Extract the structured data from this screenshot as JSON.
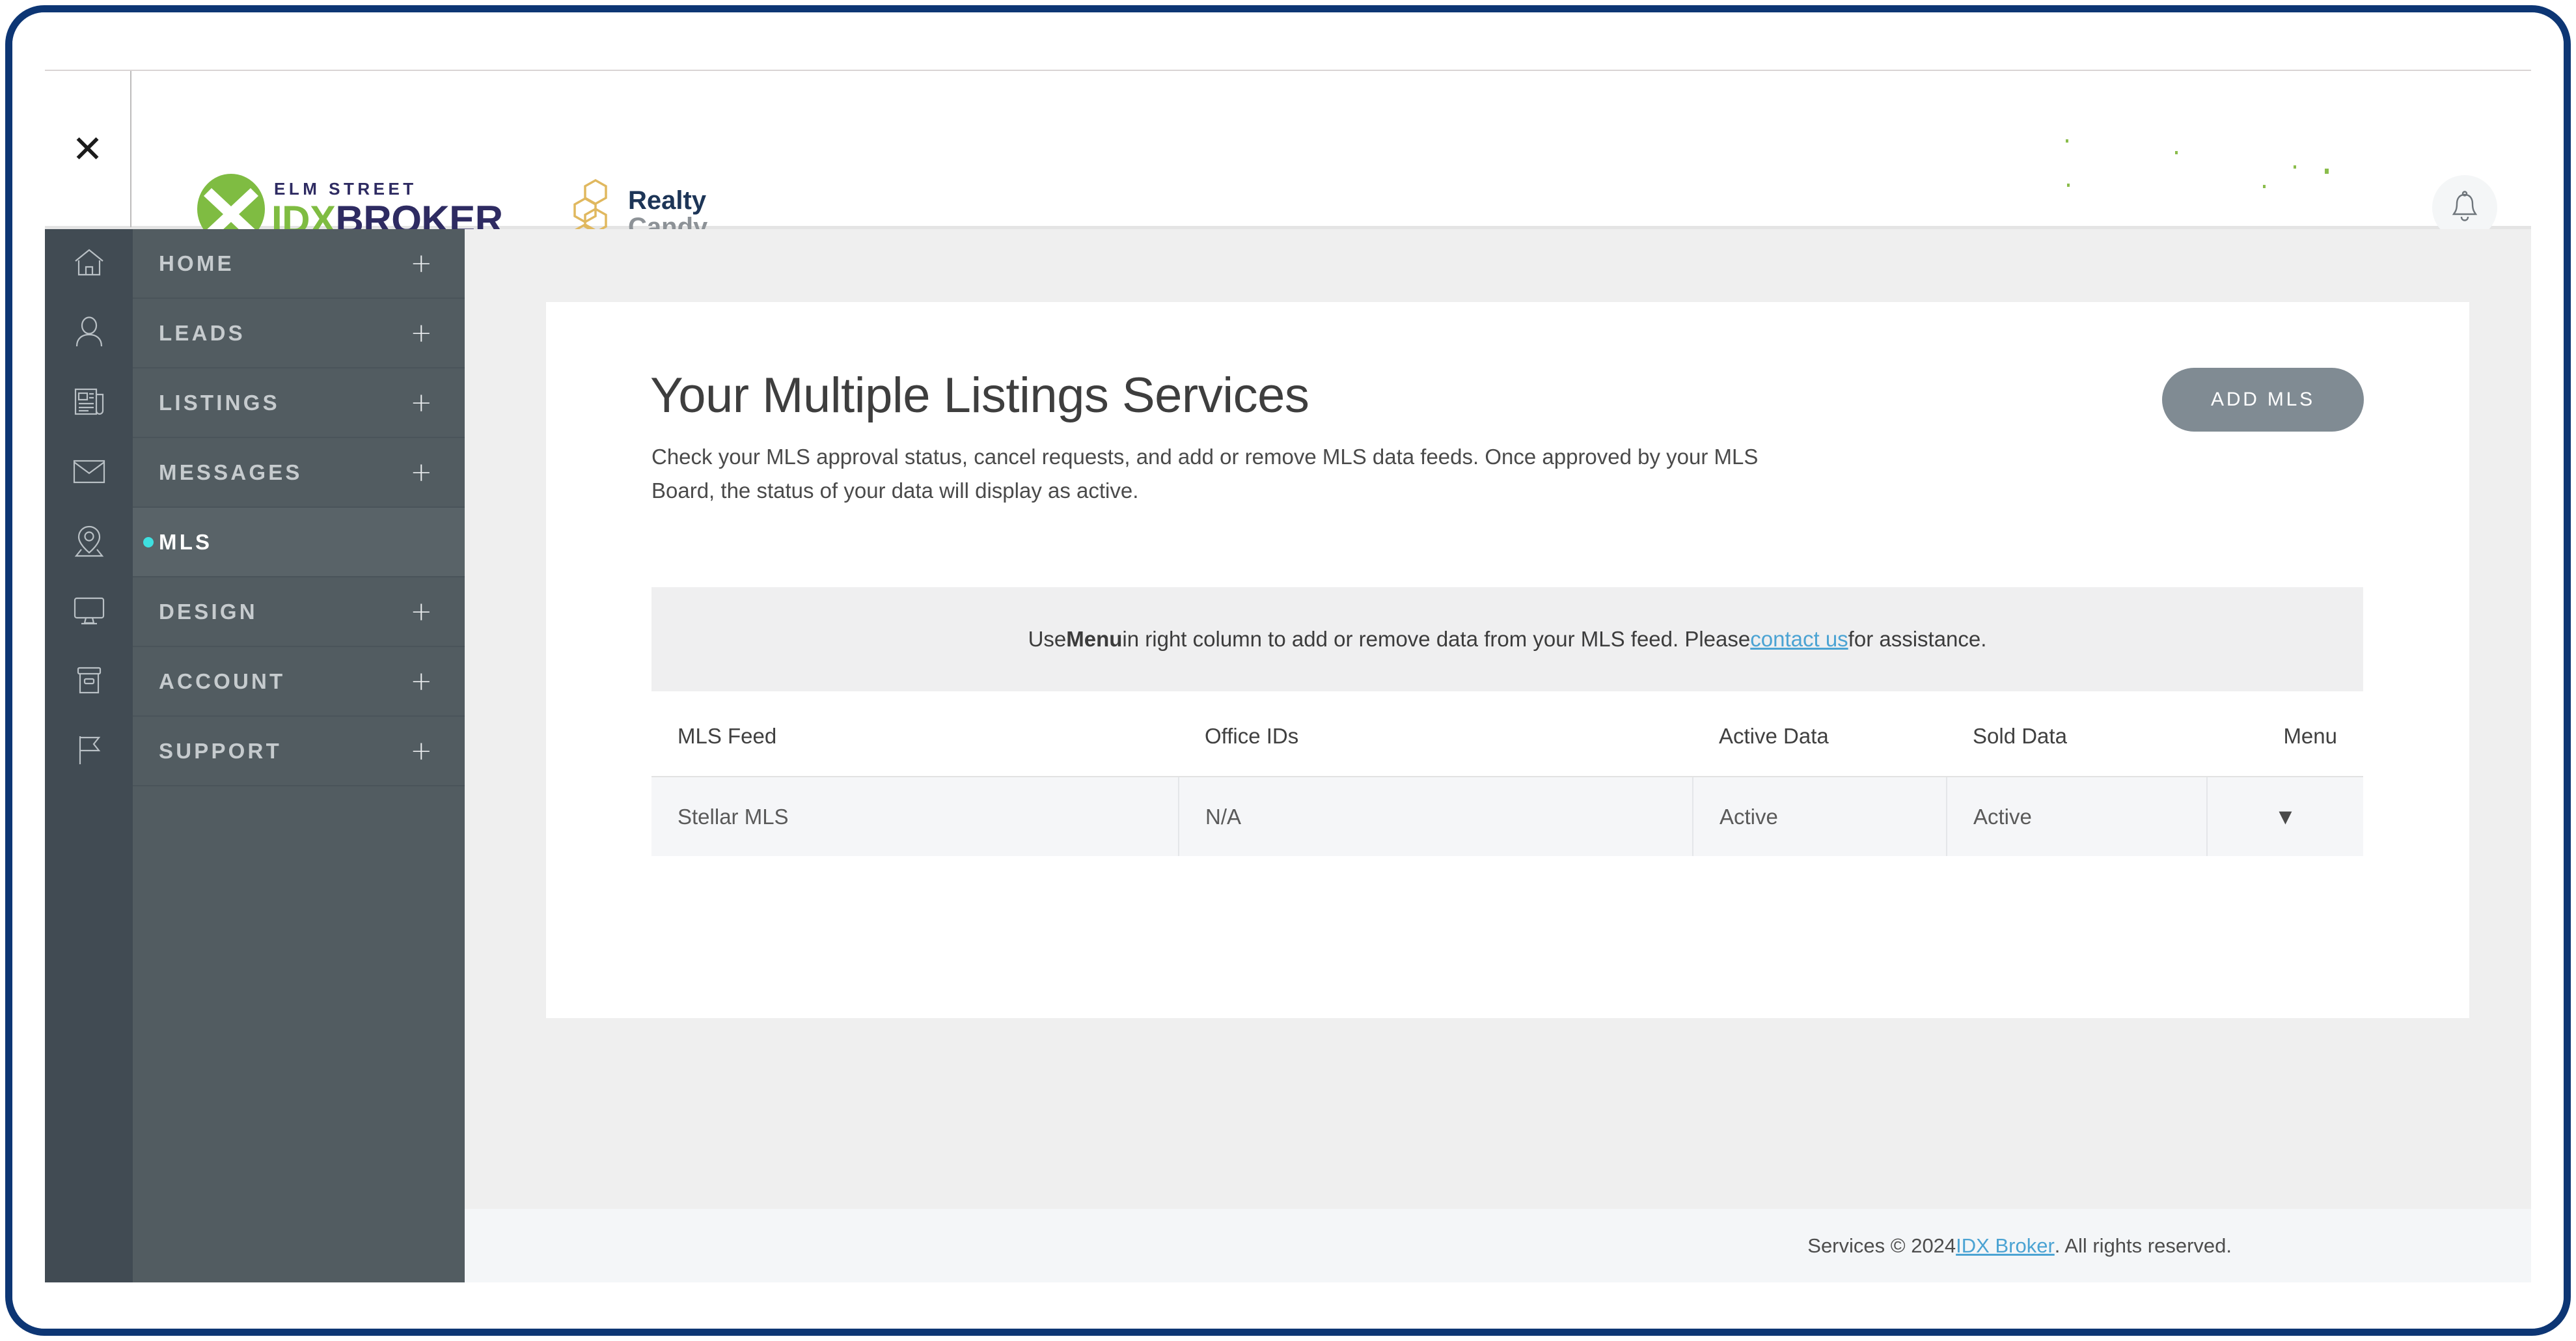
{
  "frame": {
    "border_color": "#0d3674"
  },
  "header": {
    "close_icon": "close-icon",
    "close_glyph": "✕",
    "logo_idx": {
      "eyebrow": "ELM STREET",
      "name_green": "IDX",
      "name_navy": "BROKER",
      "mark_letter": "X",
      "green": "#7fbc42",
      "navy": "#2e2b62"
    },
    "logo_realty": {
      "line1": "Realty",
      "line2": "Candy",
      "navy": "#1d3557",
      "gray": "#8d9297",
      "gold": "#e0b85f"
    },
    "bell_icon": "bell-icon"
  },
  "icon_rail": [
    {
      "name": "home-icon"
    },
    {
      "name": "user-icon"
    },
    {
      "name": "newspaper-icon"
    },
    {
      "name": "envelope-icon"
    },
    {
      "name": "map-pin-icon"
    },
    {
      "name": "monitor-icon"
    },
    {
      "name": "archive-box-icon"
    },
    {
      "name": "flag-icon"
    }
  ],
  "sidebar": {
    "items": [
      {
        "label": "HOME",
        "expand": "+",
        "active": false
      },
      {
        "label": "LEADS",
        "expand": "+",
        "active": false
      },
      {
        "label": "LISTINGS",
        "expand": "+",
        "active": false
      },
      {
        "label": "MESSAGES",
        "expand": "+",
        "active": false
      },
      {
        "label": "MLS",
        "expand": "",
        "active": true
      },
      {
        "label": "DESIGN",
        "expand": "+",
        "active": false
      },
      {
        "label": "ACCOUNT",
        "expand": "+",
        "active": false
      },
      {
        "label": "SUPPORT",
        "expand": "+",
        "active": false
      }
    ],
    "active_dot_color": "#3ee0e0"
  },
  "main": {
    "title": "Your Multiple Listings Services",
    "description": "Check your MLS approval status, cancel requests, and add or remove MLS data feeds. Once approved by your MLS Board, the status of your data will display as active.",
    "add_mls_label": "ADD MLS",
    "notice": {
      "part1": "Use ",
      "bold": "Menu",
      "part2": " in right column to add or remove data from your MLS feed. Please ",
      "link": "contact us",
      "part3": " for assistance."
    },
    "table": {
      "columns": [
        "MLS Feed",
        "Office IDs",
        "Active Data",
        "Sold Data",
        "Menu"
      ],
      "rows": [
        {
          "mls_feed": "Stellar MLS",
          "office_ids": "N/A",
          "active_data": "Active",
          "sold_data": "Active",
          "menu_icon": "caret-down-icon",
          "menu_glyph": "▼"
        }
      ]
    }
  },
  "footer": {
    "prefix": "Services © 2024 ",
    "link": "IDX Broker",
    "suffix": ". All rights reserved."
  }
}
